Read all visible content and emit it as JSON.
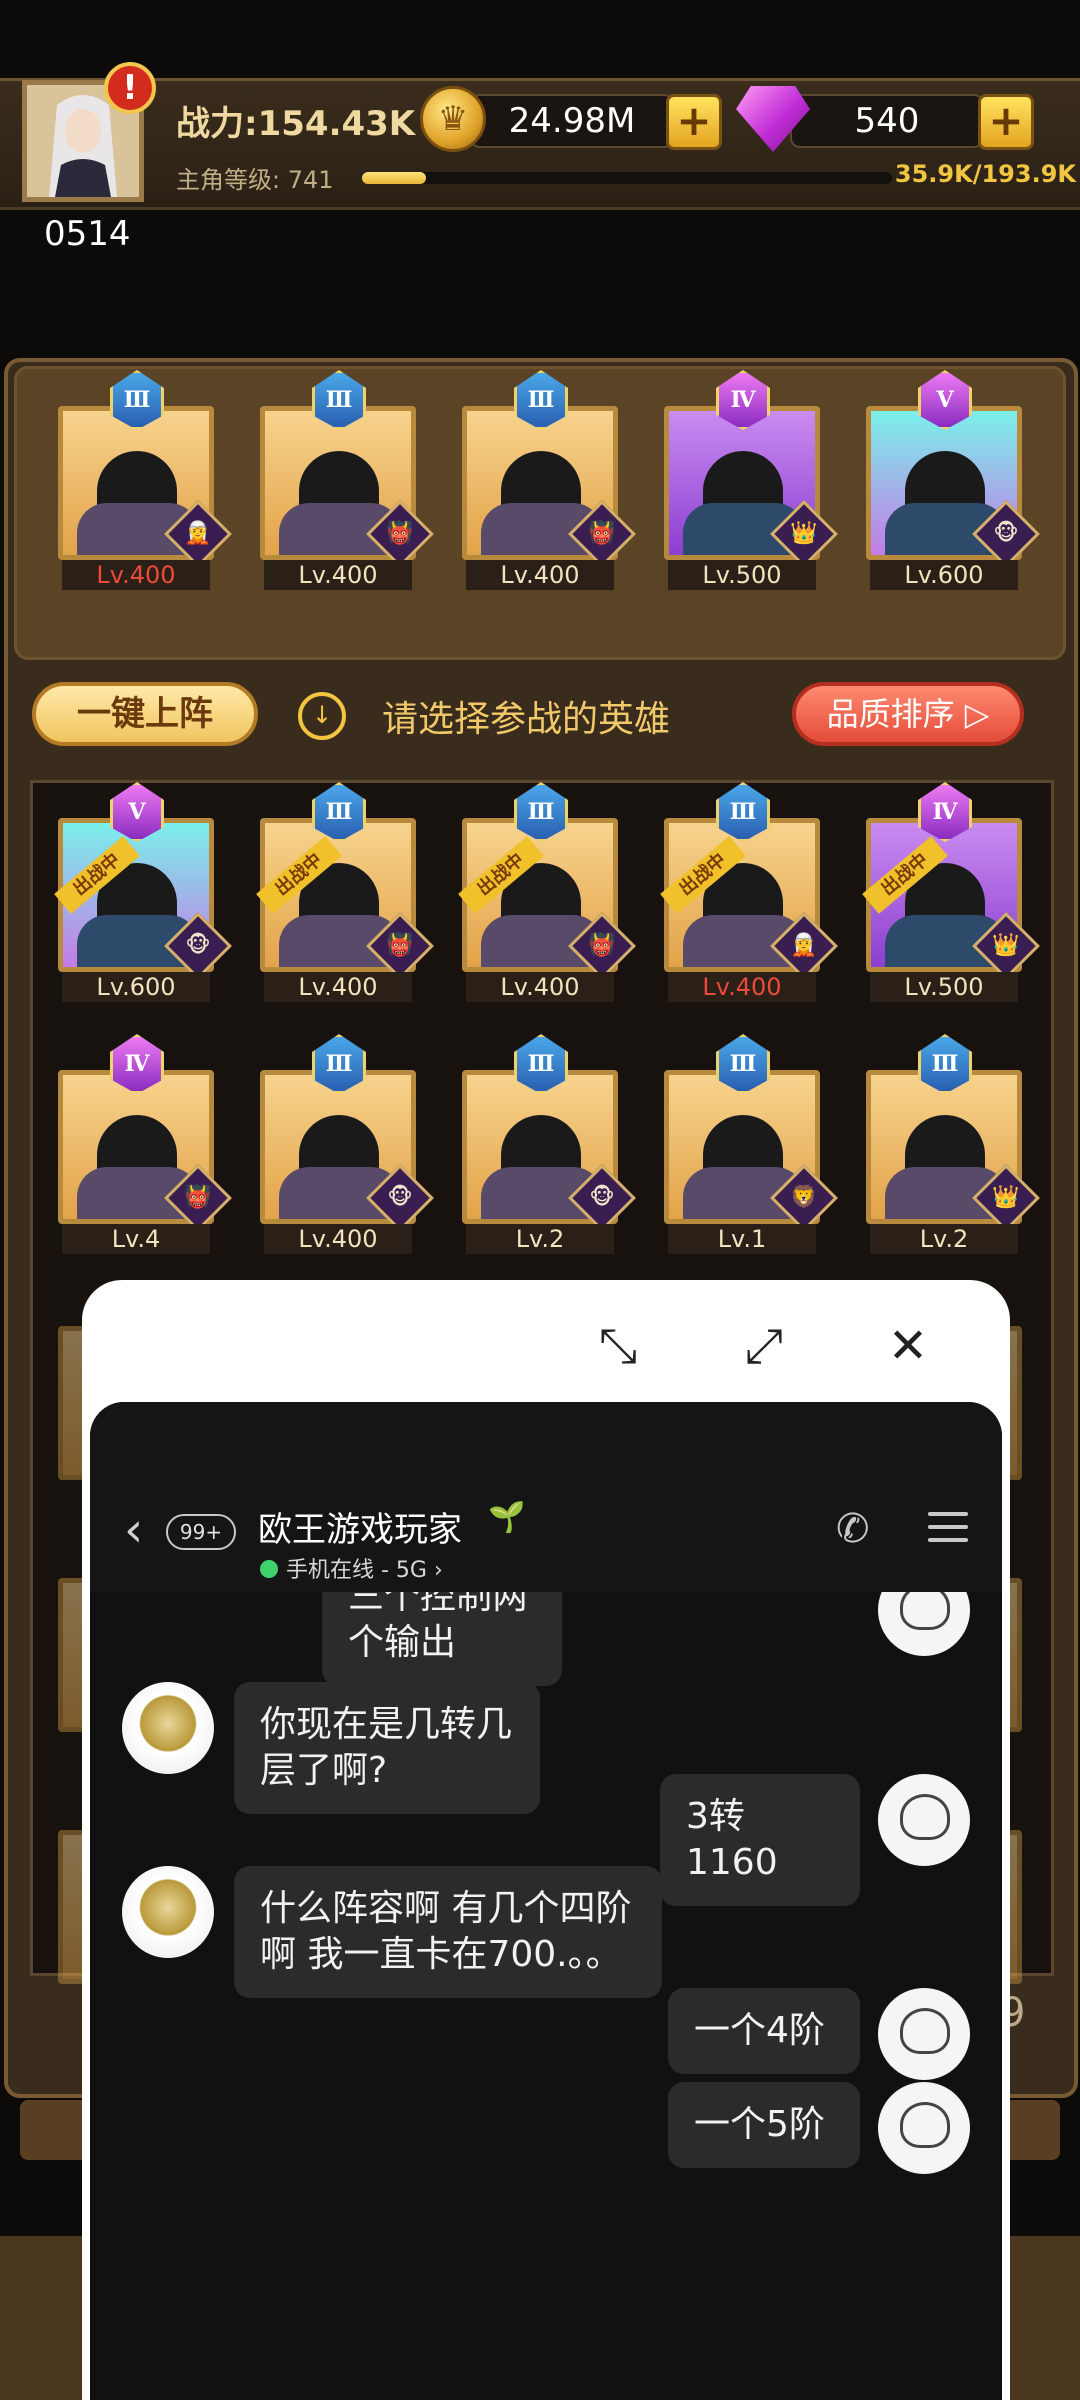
{
  "top": {
    "player_id": "0514",
    "power": "战力:154.43K",
    "level_label": "主角等级: 741",
    "xp_fraction": 0.12,
    "xp_text": "35.9K/193.9K",
    "gold": "24.98M",
    "gems": "540",
    "alert": "!",
    "plus": "+",
    "coin_glyph": "♛"
  },
  "team": [
    {
      "rank": "Ⅲ",
      "level": "Lv.400",
      "bg": "orange",
      "red": true,
      "elem": "🧝",
      "badge": "blue"
    },
    {
      "rank": "Ⅲ",
      "level": "Lv.400",
      "bg": "orange",
      "red": false,
      "elem": "👹",
      "badge": "blue"
    },
    {
      "rank": "Ⅲ",
      "level": "Lv.400",
      "bg": "orange",
      "red": false,
      "elem": "👹",
      "badge": "blue"
    },
    {
      "rank": "Ⅳ",
      "level": "Lv.500",
      "bg": "purple",
      "red": false,
      "elem": "👑",
      "badge": "purple"
    },
    {
      "rank": "Ⅴ",
      "level": "Lv.600",
      "bg": "cyan",
      "red": false,
      "elem": "🐵",
      "badge": "purple"
    }
  ],
  "controls": {
    "auto_deploy": "一键上阵",
    "hint": "请选择参战的英雄",
    "sort": "品质排序 ▷",
    "down_arrow": "↓"
  },
  "roster_row1": [
    {
      "rank": "Ⅴ",
      "level": "Lv.600",
      "bg": "cyan",
      "red": false,
      "tag": "出战中",
      "elem": "🐵",
      "badge": "purple"
    },
    {
      "rank": "Ⅲ",
      "level": "Lv.400",
      "bg": "orange",
      "red": false,
      "tag": "出战中",
      "elem": "👹",
      "badge": "blue"
    },
    {
      "rank": "Ⅲ",
      "level": "Lv.400",
      "bg": "orange",
      "red": false,
      "tag": "出战中",
      "elem": "👹",
      "badge": "blue"
    },
    {
      "rank": "Ⅲ",
      "level": "Lv.400",
      "bg": "orange",
      "red": true,
      "tag": "出战中",
      "elem": "🧝",
      "badge": "blue"
    },
    {
      "rank": "Ⅳ",
      "level": "Lv.500",
      "bg": "purple",
      "red": false,
      "tag": "出战中",
      "elem": "👑",
      "badge": "purple"
    }
  ],
  "roster_row2": [
    {
      "rank": "Ⅳ",
      "level": "Lv.4",
      "bg": "orange",
      "red": false,
      "elem": "👹",
      "badge": "purple"
    },
    {
      "rank": "Ⅲ",
      "level": "Lv.400",
      "bg": "orange",
      "red": false,
      "elem": "🐵",
      "badge": "blue"
    },
    {
      "rank": "Ⅲ",
      "level": "Lv.2",
      "bg": "orange",
      "red": false,
      "elem": "🐵",
      "badge": "blue"
    },
    {
      "rank": "Ⅲ",
      "level": "Lv.1",
      "bg": "orange",
      "red": false,
      "elem": "🦁",
      "badge": "blue"
    },
    {
      "rank": "Ⅲ",
      "level": "Lv.2",
      "bg": "orange",
      "red": false,
      "elem": "👑",
      "badge": "blue"
    }
  ],
  "side_number": "9",
  "window_controls": {
    "minimize": "⤡",
    "expand": "⤢",
    "close": "✕"
  },
  "chat": {
    "back": "‹",
    "unread": "99+",
    "contact": "欧王游戏玩家",
    "sprout": "🌱",
    "status": "手机在线 - 5G ›",
    "phone": "✆",
    "messages": [
      {
        "from": "self",
        "text": "三个控制两个输出"
      },
      {
        "from": "peer",
        "text": "你现在是几转几层了啊?"
      },
      {
        "from": "self",
        "text": "3转1160"
      },
      {
        "from": "peer",
        "text": "什么阵容啊  有几个四阶啊  我一直卡在700.。。"
      },
      {
        "from": "self",
        "text": "一个4阶"
      },
      {
        "from": "self",
        "text": "一个5阶"
      }
    ]
  },
  "colors": {
    "accent": "#f1c540",
    "chat_bg": "#111111",
    "bubble": "#2b2b2b"
  }
}
